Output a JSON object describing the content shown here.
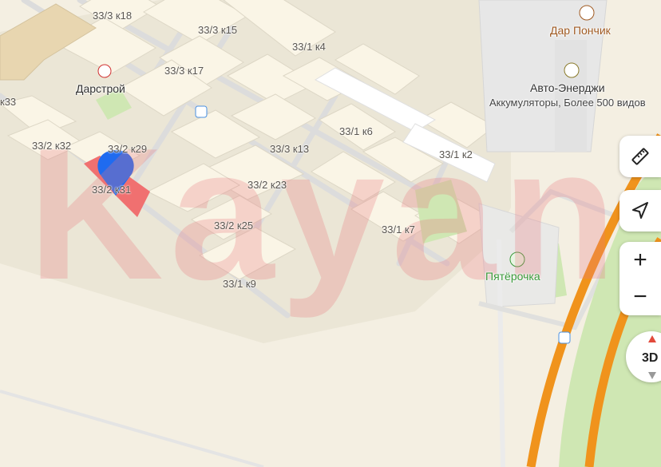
{
  "map": {
    "building_labels": [
      "33/3 к18",
      "33/3 к15",
      "33/1 к4",
      "33/3 к17",
      "к33",
      "33/1 к6",
      "33/2 к32",
      "33/2 к29",
      "33/3 к13",
      "33/1 к2",
      "33/2 к31",
      "33/2 к23",
      "33/2 к25",
      "33/1 к7",
      "33/1 к9"
    ],
    "poi": {
      "darstroy": "Дарстрой",
      "dar_ponchik": "Дар Пончик",
      "avto_energy": "Авто-Энерджи",
      "avto_energy_desc": "Аккумуляторы, Более 500 видов",
      "pyaterochka": "Пятёрочка"
    },
    "watermark": "Kayan"
  },
  "controls": {
    "ruler_icon": "ruler-icon",
    "location_icon": "navigation-arrow-icon",
    "zoom_in": "+",
    "zoom_out": "−",
    "compass_label": "3D"
  },
  "colors": {
    "background": "#f4efe2",
    "building": "#faf5e6",
    "road": "#e0e0de",
    "highway": "#f0931c",
    "green": "#cfe7b3",
    "marker_blue": "#1f6bf0",
    "selected_building": "#f07070",
    "poi_brown": "#a05a22",
    "poi_green": "#3a9a3a"
  }
}
